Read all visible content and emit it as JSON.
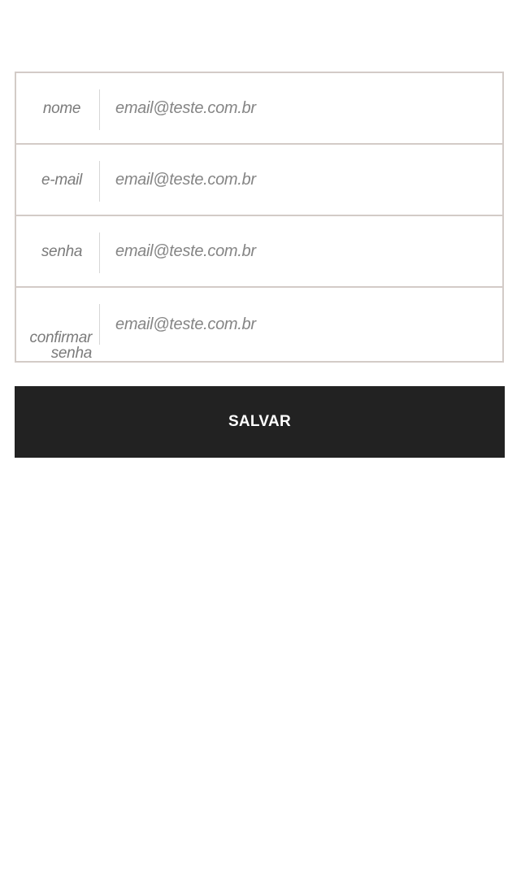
{
  "form": {
    "rows": [
      {
        "label": "nome",
        "placeholder": "email@teste.com.br",
        "value": ""
      },
      {
        "label": "e-mail",
        "placeholder": "email@teste.com.br",
        "value": ""
      },
      {
        "label": "senha",
        "placeholder": "email@teste.com.br",
        "value": ""
      },
      {
        "label_line1": "confirmar",
        "label_line2": "senha",
        "placeholder": "email@teste.com.br",
        "value": ""
      }
    ]
  },
  "actions": {
    "save_label": "SALVAR"
  },
  "colors": {
    "border": "#d3cbc7",
    "button_bg": "#222222",
    "button_text": "#ffffff",
    "label_text": "#7b7b7b"
  }
}
